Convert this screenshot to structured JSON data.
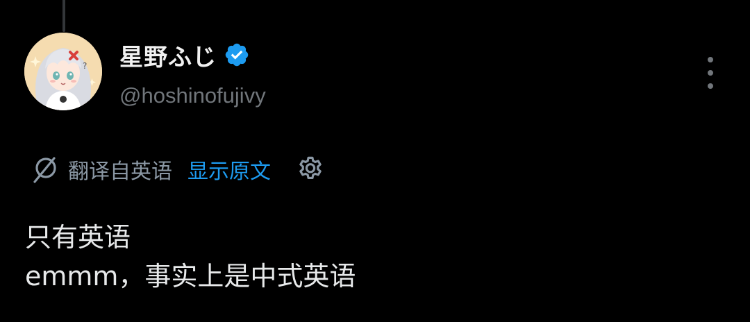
{
  "author": {
    "display_name": "星野ふじ",
    "handle": "@hoshinofujivy",
    "verified": true,
    "avatar_icon": "anime-girl-avatar"
  },
  "translation_bar": {
    "icon": "translate-icon",
    "translated_from": "翻译自英语",
    "show_original": "显示原文",
    "settings_icon": "gear-icon"
  },
  "tweet": {
    "lines": [
      "只有英语",
      "emmm，事实上是中式英语"
    ]
  },
  "colors": {
    "background": "#000000",
    "text": "#e7e9ea",
    "secondary": "#71767b",
    "link": "#1d9bf0",
    "verified": "#1d9bf0"
  }
}
